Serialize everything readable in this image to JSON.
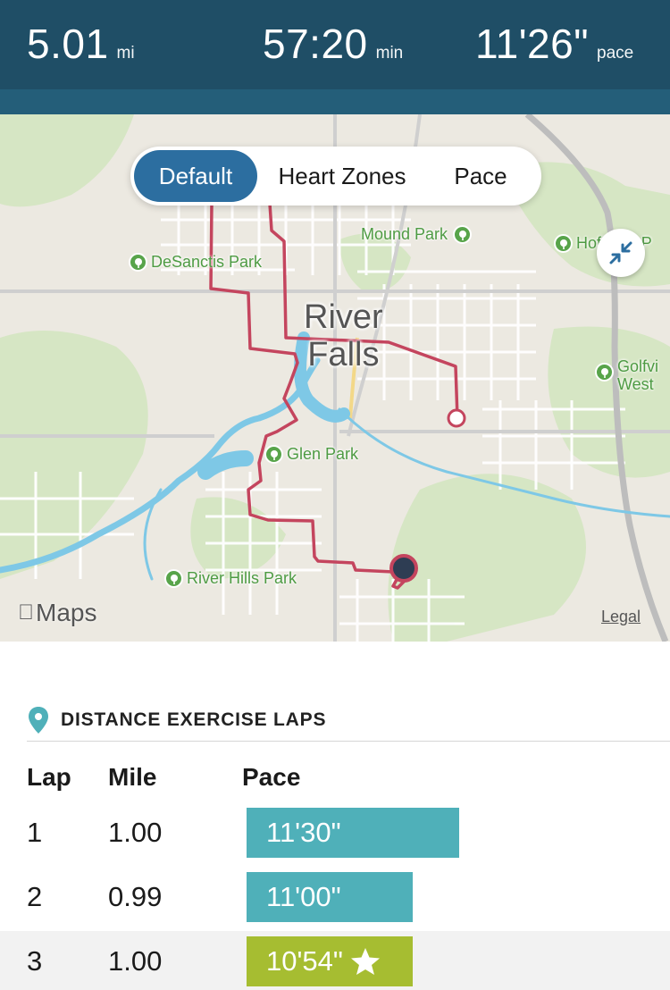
{
  "stats": {
    "distance": {
      "value": "5.01",
      "unit": "mi"
    },
    "duration": {
      "value": "57:20",
      "unit": "min"
    },
    "pace": {
      "value": "11'26\"",
      "unit": "pace"
    }
  },
  "map": {
    "view_modes": [
      "Default",
      "Heart Zones",
      "Pace"
    ],
    "selected_view": "Default",
    "city": [
      "River",
      "Falls"
    ],
    "labels": {
      "mound_park": "Mound Park",
      "desanctis_park": "DeSanctis Park",
      "glen_park": "Glen Park",
      "river_hills_park": "River Hills Park",
      "hoffman_park": "Hoffman P",
      "golfview_west": [
        "Golfvi",
        "West"
      ]
    },
    "provider": "Maps",
    "legal": "Legal",
    "route_color": "#c4455e",
    "water_color": "#7ec8e6",
    "park_color": "#58a44a"
  },
  "laps": {
    "title": "DISTANCE EXERCISE LAPS",
    "columns": {
      "lap": "Lap",
      "mile": "Mile",
      "pace": "Pace"
    },
    "rows": [
      {
        "lap": "1",
        "mile": "1.00",
        "pace": "11'30\"",
        "color": "#4fb0b9",
        "fastest": false
      },
      {
        "lap": "2",
        "mile": "0.99",
        "pace": "11'00\"",
        "color": "#4fb0b9",
        "fastest": false
      },
      {
        "lap": "3",
        "mile": "1.00",
        "pace": "10'54\"",
        "color": "#a6bd31",
        "fastest": true
      }
    ]
  }
}
